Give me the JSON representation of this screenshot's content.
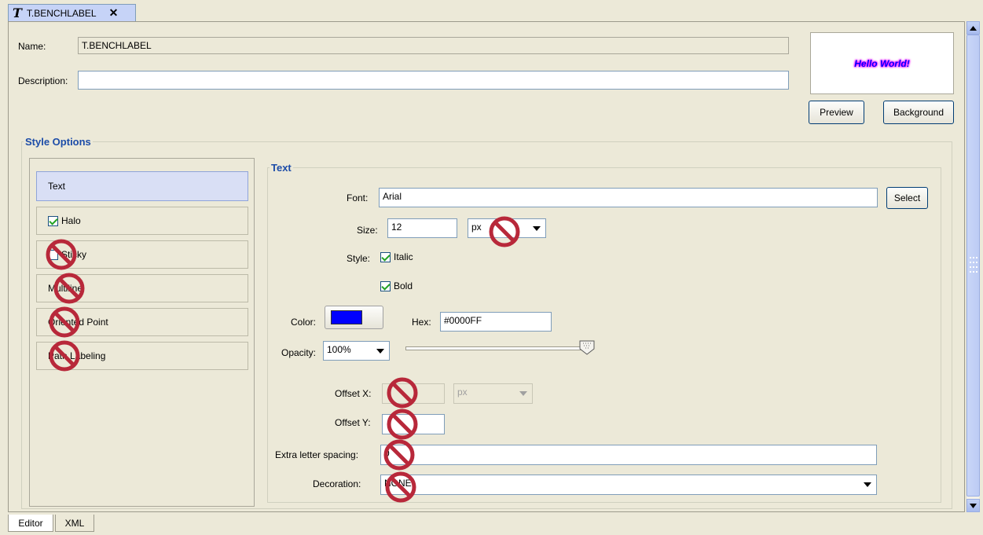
{
  "top_tab": {
    "icon": "text-style-icon",
    "label": "T.BENCHLABEL",
    "close": "✕"
  },
  "header": {
    "name_label": "Name:",
    "name_value": "T.BENCHLABEL",
    "description_label": "Description:",
    "description_value": ""
  },
  "preview": {
    "sample_text": "Hello World!",
    "preview_button": "Preview",
    "background_button": "Background"
  },
  "style_options": {
    "legend": "Style Options",
    "categories": [
      {
        "label": "Text",
        "selected": true,
        "has_checkbox": false
      },
      {
        "label": "Halo",
        "checked": true,
        "has_checkbox": true
      },
      {
        "label": "Sticky",
        "checked": false,
        "has_checkbox": true,
        "disabled_icon": true
      },
      {
        "label": "Multiline",
        "has_checkbox": false,
        "disabled_icon": true
      },
      {
        "label": "Oriented Point",
        "has_checkbox": false,
        "disabled_icon": true
      },
      {
        "label": "Path Labeling",
        "has_checkbox": false,
        "disabled_icon": true
      }
    ]
  },
  "text_panel": {
    "legend": "Text",
    "font_label": "Font:",
    "font_value": "Arial",
    "select_button": "Select",
    "size_label": "Size:",
    "size_value": "12",
    "size_unit": "px",
    "style_label": "Style:",
    "italic_label": "Italic",
    "italic_checked": true,
    "bold_label": "Bold",
    "bold_checked": true,
    "color_label": "Color:",
    "color_value": "#0000FF",
    "hex_label": "Hex:",
    "hex_value": "#0000FF",
    "opacity_label": "Opacity:",
    "opacity_value": "100%",
    "opacity_level": 1.0,
    "offset_x_label": "Offset X:",
    "offset_x_value": "",
    "offset_x_unit": "px",
    "offset_y_label": "Offset Y:",
    "offset_y_value": "",
    "letter_spacing_label": "Extra letter spacing:",
    "letter_spacing_value": "0",
    "decoration_label": "Decoration:",
    "decoration_value": "NONE"
  },
  "bottom_tabs": [
    {
      "label": "Editor",
      "active": true
    },
    {
      "label": "XML",
      "active": false
    }
  ],
  "colors": {
    "accent": "#1c4ca8",
    "swatch": "#0000FF",
    "disabled_marker": "#c0303a"
  }
}
